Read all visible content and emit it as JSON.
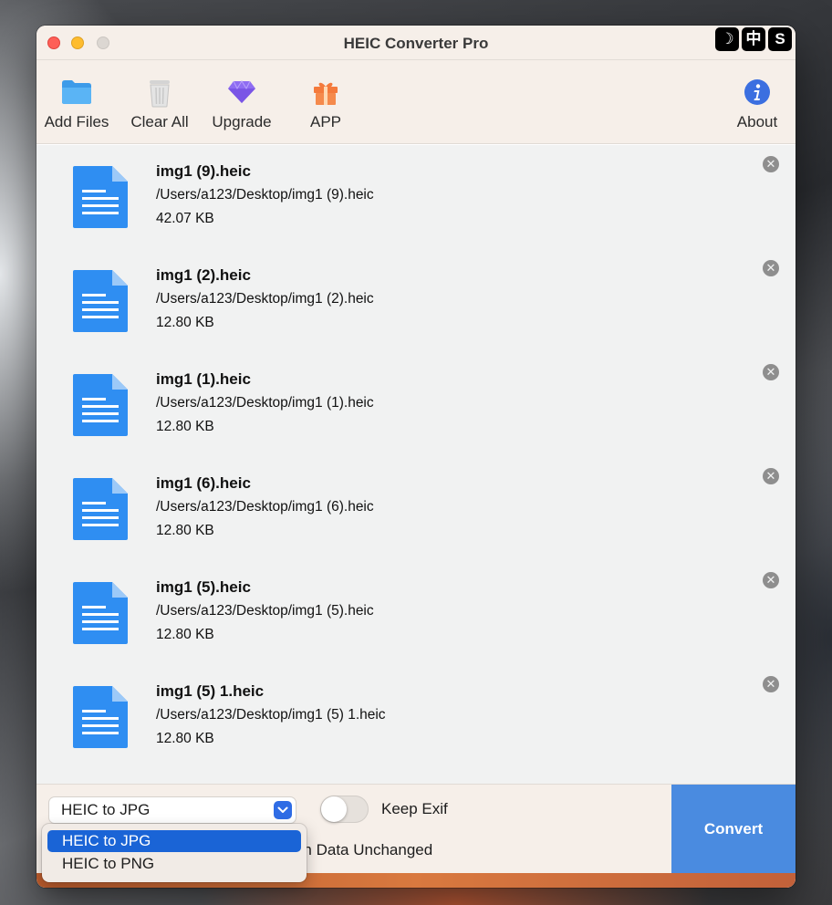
{
  "window": {
    "title": "HEIC Converter Pro",
    "ime_glyphs": [
      "☽",
      "中",
      "S"
    ]
  },
  "toolbar": {
    "add_files": "Add Files",
    "clear_all": "Clear All",
    "upgrade": "Upgrade",
    "app": "APP",
    "about": "About"
  },
  "files": [
    {
      "name": "img1 (9).heic",
      "path": "/Users/a123/Desktop/img1 (9).heic",
      "size": "42.07 KB"
    },
    {
      "name": "img1 (2).heic",
      "path": "/Users/a123/Desktop/img1 (2).heic",
      "size": "12.80 KB"
    },
    {
      "name": "img1 (1).heic",
      "path": "/Users/a123/Desktop/img1 (1).heic",
      "size": "12.80 KB"
    },
    {
      "name": "img1 (6).heic",
      "path": "/Users/a123/Desktop/img1 (6).heic",
      "size": "12.80 KB"
    },
    {
      "name": "img1 (5).heic",
      "path": "/Users/a123/Desktop/img1 (5).heic",
      "size": "12.80 KB"
    },
    {
      "name": "img1 (5) 1.heic",
      "path": "/Users/a123/Desktop/img1 (5) 1.heic",
      "size": "12.80 KB"
    }
  ],
  "bottom": {
    "format_selected": "HEIC to JPG",
    "keep_exif_label": "Keep Exif",
    "keep_exif_on": false,
    "keep_location_partial": "ation Data Unchanged",
    "convert_label": "Convert"
  },
  "dropdown": {
    "options": [
      "HEIC to JPG",
      "HEIC to PNG"
    ],
    "selected_index": 0
  },
  "colors": {
    "accent": "#4a8be0",
    "selection": "#1a64d6",
    "doc_icon": "#2f8ef2"
  }
}
